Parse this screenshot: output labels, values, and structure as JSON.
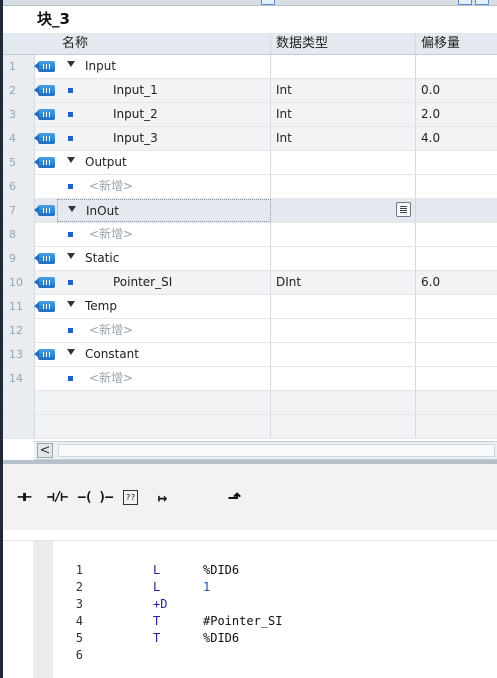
{
  "block": {
    "title": "块_3"
  },
  "table": {
    "headers": {
      "name": "名称",
      "type": "数据类型",
      "offset": "偏移量"
    },
    "rows": [
      {
        "num": "1",
        "kind": "section",
        "name": "Input",
        "type": "",
        "offset": ""
      },
      {
        "num": "2",
        "kind": "var",
        "name": "Input_1",
        "type": "Int",
        "offset": "0.0"
      },
      {
        "num": "3",
        "kind": "var",
        "name": "Input_2",
        "type": "Int",
        "offset": "2.0"
      },
      {
        "num": "4",
        "kind": "var",
        "name": "Input_3",
        "type": "Int",
        "offset": "4.0"
      },
      {
        "num": "5",
        "kind": "section",
        "name": "Output",
        "type": "",
        "offset": ""
      },
      {
        "num": "6",
        "kind": "new",
        "name": "<新增>",
        "type": "",
        "offset": ""
      },
      {
        "num": "7",
        "kind": "section",
        "name": "InOut",
        "type": "",
        "offset": ""
      },
      {
        "num": "8",
        "kind": "new",
        "name": "<新增>",
        "type": "",
        "offset": ""
      },
      {
        "num": "9",
        "kind": "section",
        "name": "Static",
        "type": "",
        "offset": ""
      },
      {
        "num": "10",
        "kind": "var",
        "name": "Pointer_SI",
        "type": "DInt",
        "offset": "6.0"
      },
      {
        "num": "11",
        "kind": "section",
        "name": "Temp",
        "type": "",
        "offset": ""
      },
      {
        "num": "12",
        "kind": "new",
        "name": "<新增>",
        "type": "",
        "offset": ""
      },
      {
        "num": "13",
        "kind": "section",
        "name": "Constant",
        "type": "",
        "offset": ""
      },
      {
        "num": "14",
        "kind": "new",
        "name": "<新增>",
        "type": "",
        "offset": ""
      }
    ]
  },
  "scrollbar": {
    "left_arrow": "<"
  },
  "ladder_toolbar": {
    "items": [
      {
        "icon": "normally-open-contact-icon",
        "glyph": "⊣⊢"
      },
      {
        "icon": "normally-closed-contact-icon",
        "glyph": "⊣/⊢"
      },
      {
        "icon": "coil-icon",
        "glyph": "–( )–"
      },
      {
        "icon": "empty-box-icon",
        "glyph": "??"
      },
      {
        "icon": "open-branch-icon",
        "glyph": "↦"
      },
      {
        "icon": "close-branch-icon",
        "glyph": "⬏"
      }
    ]
  },
  "code": {
    "lines": [
      {
        "n": "1",
        "op": "L",
        "arg": "%DID6"
      },
      {
        "n": "2",
        "op": "L",
        "arg": "1"
      },
      {
        "n": "3",
        "op": "+D",
        "arg": ""
      },
      {
        "n": "4",
        "op": "T",
        "arg": "#Pointer_SI"
      },
      {
        "n": "5",
        "op": "T",
        "arg": "%DID6"
      },
      {
        "n": "6",
        "op": "",
        "arg": ""
      }
    ]
  },
  "colors": {
    "accent": "#1c64c4",
    "header_bg": "#e4e9ef",
    "keyword": "#1f1f9a"
  }
}
